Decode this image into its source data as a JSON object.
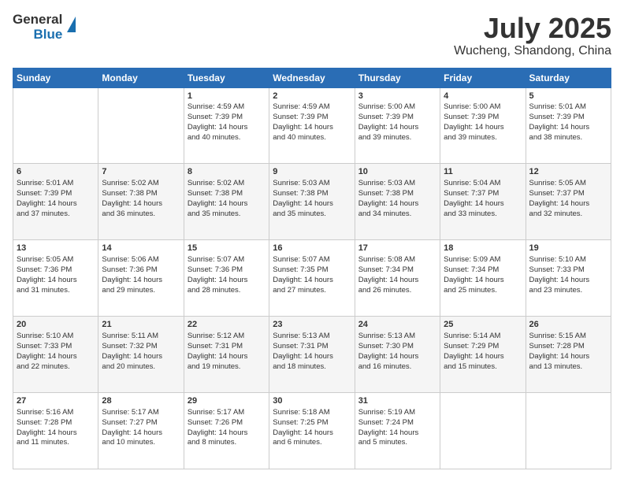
{
  "logo": {
    "line1": "General",
    "line2": "Blue"
  },
  "header": {
    "month": "July 2025",
    "location": "Wucheng, Shandong, China"
  },
  "weekdays": [
    "Sunday",
    "Monday",
    "Tuesday",
    "Wednesday",
    "Thursday",
    "Friday",
    "Saturday"
  ],
  "weeks": [
    [
      {
        "day": "",
        "lines": []
      },
      {
        "day": "",
        "lines": []
      },
      {
        "day": "1",
        "lines": [
          "Sunrise: 4:59 AM",
          "Sunset: 7:39 PM",
          "Daylight: 14 hours",
          "and 40 minutes."
        ]
      },
      {
        "day": "2",
        "lines": [
          "Sunrise: 4:59 AM",
          "Sunset: 7:39 PM",
          "Daylight: 14 hours",
          "and 40 minutes."
        ]
      },
      {
        "day": "3",
        "lines": [
          "Sunrise: 5:00 AM",
          "Sunset: 7:39 PM",
          "Daylight: 14 hours",
          "and 39 minutes."
        ]
      },
      {
        "day": "4",
        "lines": [
          "Sunrise: 5:00 AM",
          "Sunset: 7:39 PM",
          "Daylight: 14 hours",
          "and 39 minutes."
        ]
      },
      {
        "day": "5",
        "lines": [
          "Sunrise: 5:01 AM",
          "Sunset: 7:39 PM",
          "Daylight: 14 hours",
          "and 38 minutes."
        ]
      }
    ],
    [
      {
        "day": "6",
        "lines": [
          "Sunrise: 5:01 AM",
          "Sunset: 7:39 PM",
          "Daylight: 14 hours",
          "and 37 minutes."
        ]
      },
      {
        "day": "7",
        "lines": [
          "Sunrise: 5:02 AM",
          "Sunset: 7:38 PM",
          "Daylight: 14 hours",
          "and 36 minutes."
        ]
      },
      {
        "day": "8",
        "lines": [
          "Sunrise: 5:02 AM",
          "Sunset: 7:38 PM",
          "Daylight: 14 hours",
          "and 35 minutes."
        ]
      },
      {
        "day": "9",
        "lines": [
          "Sunrise: 5:03 AM",
          "Sunset: 7:38 PM",
          "Daylight: 14 hours",
          "and 35 minutes."
        ]
      },
      {
        "day": "10",
        "lines": [
          "Sunrise: 5:03 AM",
          "Sunset: 7:38 PM",
          "Daylight: 14 hours",
          "and 34 minutes."
        ]
      },
      {
        "day": "11",
        "lines": [
          "Sunrise: 5:04 AM",
          "Sunset: 7:37 PM",
          "Daylight: 14 hours",
          "and 33 minutes."
        ]
      },
      {
        "day": "12",
        "lines": [
          "Sunrise: 5:05 AM",
          "Sunset: 7:37 PM",
          "Daylight: 14 hours",
          "and 32 minutes."
        ]
      }
    ],
    [
      {
        "day": "13",
        "lines": [
          "Sunrise: 5:05 AM",
          "Sunset: 7:36 PM",
          "Daylight: 14 hours",
          "and 31 minutes."
        ]
      },
      {
        "day": "14",
        "lines": [
          "Sunrise: 5:06 AM",
          "Sunset: 7:36 PM",
          "Daylight: 14 hours",
          "and 29 minutes."
        ]
      },
      {
        "day": "15",
        "lines": [
          "Sunrise: 5:07 AM",
          "Sunset: 7:36 PM",
          "Daylight: 14 hours",
          "and 28 minutes."
        ]
      },
      {
        "day": "16",
        "lines": [
          "Sunrise: 5:07 AM",
          "Sunset: 7:35 PM",
          "Daylight: 14 hours",
          "and 27 minutes."
        ]
      },
      {
        "day": "17",
        "lines": [
          "Sunrise: 5:08 AM",
          "Sunset: 7:34 PM",
          "Daylight: 14 hours",
          "and 26 minutes."
        ]
      },
      {
        "day": "18",
        "lines": [
          "Sunrise: 5:09 AM",
          "Sunset: 7:34 PM",
          "Daylight: 14 hours",
          "and 25 minutes."
        ]
      },
      {
        "day": "19",
        "lines": [
          "Sunrise: 5:10 AM",
          "Sunset: 7:33 PM",
          "Daylight: 14 hours",
          "and 23 minutes."
        ]
      }
    ],
    [
      {
        "day": "20",
        "lines": [
          "Sunrise: 5:10 AM",
          "Sunset: 7:33 PM",
          "Daylight: 14 hours",
          "and 22 minutes."
        ]
      },
      {
        "day": "21",
        "lines": [
          "Sunrise: 5:11 AM",
          "Sunset: 7:32 PM",
          "Daylight: 14 hours",
          "and 20 minutes."
        ]
      },
      {
        "day": "22",
        "lines": [
          "Sunrise: 5:12 AM",
          "Sunset: 7:31 PM",
          "Daylight: 14 hours",
          "and 19 minutes."
        ]
      },
      {
        "day": "23",
        "lines": [
          "Sunrise: 5:13 AM",
          "Sunset: 7:31 PM",
          "Daylight: 14 hours",
          "and 18 minutes."
        ]
      },
      {
        "day": "24",
        "lines": [
          "Sunrise: 5:13 AM",
          "Sunset: 7:30 PM",
          "Daylight: 14 hours",
          "and 16 minutes."
        ]
      },
      {
        "day": "25",
        "lines": [
          "Sunrise: 5:14 AM",
          "Sunset: 7:29 PM",
          "Daylight: 14 hours",
          "and 15 minutes."
        ]
      },
      {
        "day": "26",
        "lines": [
          "Sunrise: 5:15 AM",
          "Sunset: 7:28 PM",
          "Daylight: 14 hours",
          "and 13 minutes."
        ]
      }
    ],
    [
      {
        "day": "27",
        "lines": [
          "Sunrise: 5:16 AM",
          "Sunset: 7:28 PM",
          "Daylight: 14 hours",
          "and 11 minutes."
        ]
      },
      {
        "day": "28",
        "lines": [
          "Sunrise: 5:17 AM",
          "Sunset: 7:27 PM",
          "Daylight: 14 hours",
          "and 10 minutes."
        ]
      },
      {
        "day": "29",
        "lines": [
          "Sunrise: 5:17 AM",
          "Sunset: 7:26 PM",
          "Daylight: 14 hours",
          "and 8 minutes."
        ]
      },
      {
        "day": "30",
        "lines": [
          "Sunrise: 5:18 AM",
          "Sunset: 7:25 PM",
          "Daylight: 14 hours",
          "and 6 minutes."
        ]
      },
      {
        "day": "31",
        "lines": [
          "Sunrise: 5:19 AM",
          "Sunset: 7:24 PM",
          "Daylight: 14 hours",
          "and 5 minutes."
        ]
      },
      {
        "day": "",
        "lines": []
      },
      {
        "day": "",
        "lines": []
      }
    ]
  ]
}
